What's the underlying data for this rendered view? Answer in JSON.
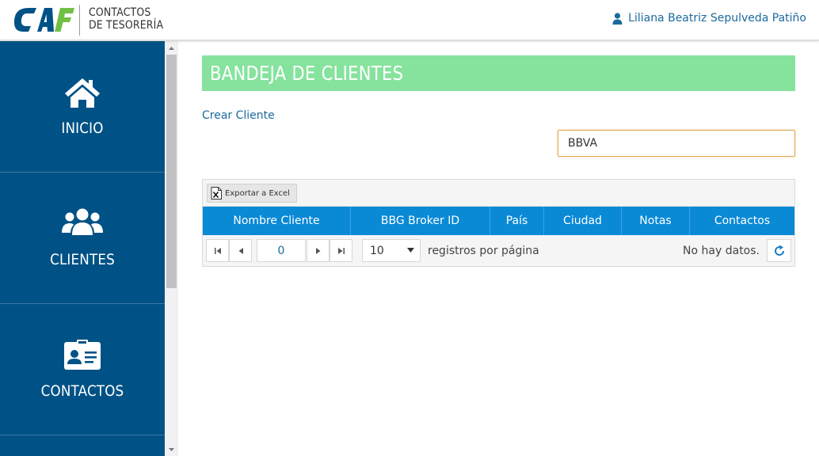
{
  "header": {
    "logo_text": "CAF",
    "app_title_line1": "CONTACTOS",
    "app_title_line2": "DE TESORERÍA",
    "user_name": "Liliana Beatriz Sepulveda Patiño",
    "colors": {
      "brand_blue": "#005286",
      "brand_green": "#71c043",
      "link": "#1b6a9c"
    }
  },
  "sidebar": {
    "items": [
      {
        "label": "INICIO",
        "icon": "home-icon"
      },
      {
        "label": "CLIENTES",
        "icon": "users-icon"
      },
      {
        "label": "CONTACTOS",
        "icon": "contact-card-icon"
      }
    ]
  },
  "main": {
    "page_title": "BANDEJA DE CLIENTES",
    "create_link": "Crear Cliente",
    "search_value": "BBVA",
    "title_bar_color": "#86e39d"
  },
  "grid": {
    "export_label": "Exportar a Excel",
    "columns": [
      "Nombre Cliente",
      "BBG Broker ID",
      "País",
      "Ciudad",
      "Notas",
      "Contactos"
    ],
    "header_color": "#0a89d5",
    "pager": {
      "current_page": "0",
      "page_size": "10",
      "per_page_label": "registros por página",
      "status": "No hay datos."
    }
  }
}
